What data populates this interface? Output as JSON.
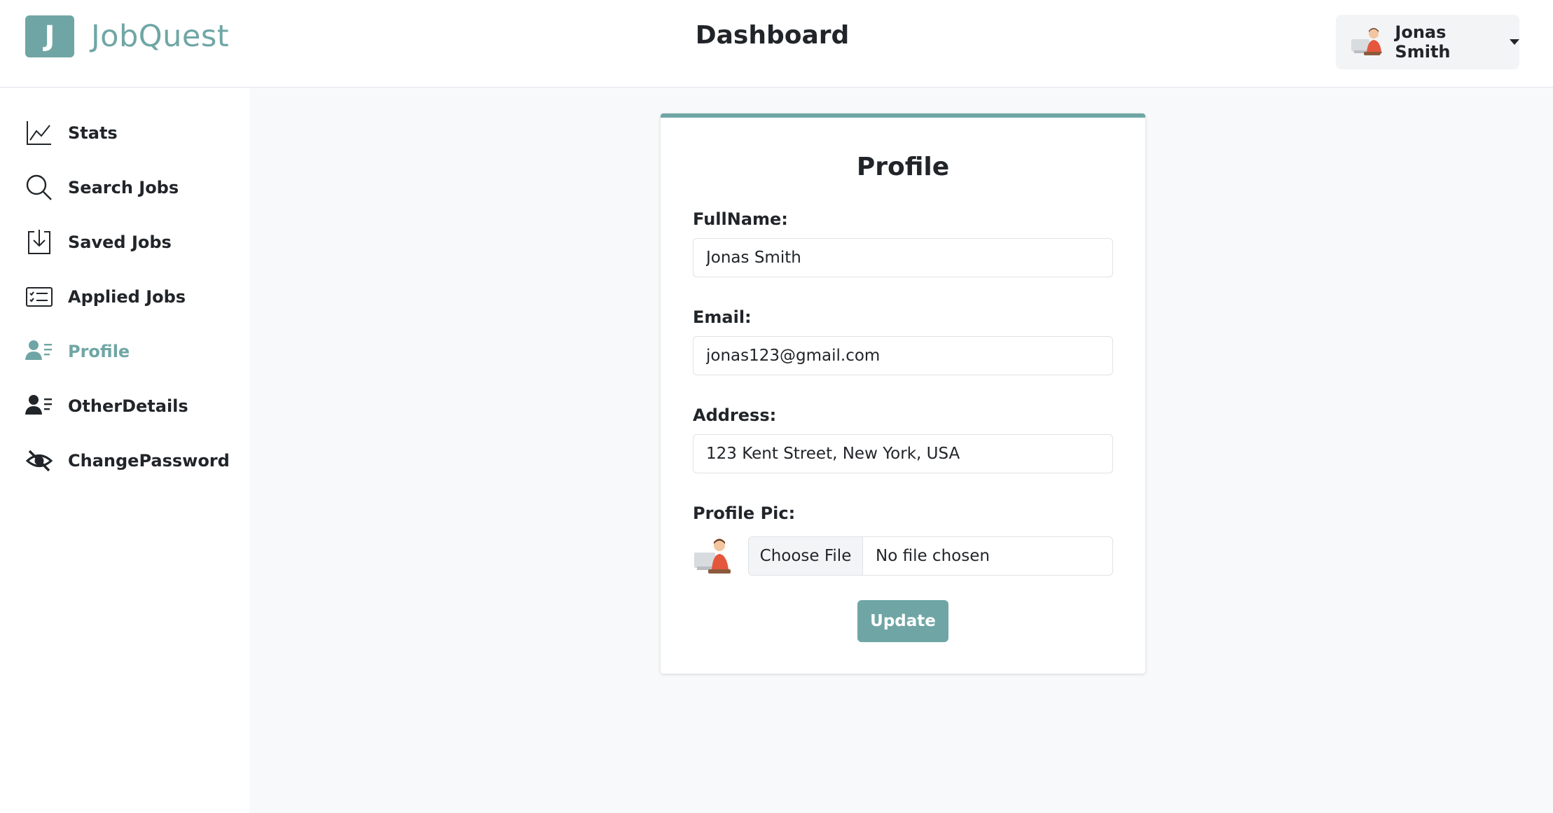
{
  "brand": {
    "initial": "J",
    "name": "JobQuest",
    "color": "#6fa6a5"
  },
  "header": {
    "title": "Dashboard"
  },
  "user": {
    "name": "Jonas Smith",
    "avatar_icon": "developer-avatar-icon"
  },
  "sidebar": {
    "items": [
      {
        "label": "Stats",
        "icon": "line-chart-icon",
        "active": false
      },
      {
        "label": "Search Jobs",
        "icon": "search-icon",
        "active": false
      },
      {
        "label": "Saved Jobs",
        "icon": "download-box-icon",
        "active": false
      },
      {
        "label": "Applied Jobs",
        "icon": "checklist-icon",
        "active": false
      },
      {
        "label": "Profile",
        "icon": "user-list-icon",
        "active": true
      },
      {
        "label": "OtherDetails",
        "icon": "user-details-icon",
        "active": false
      },
      {
        "label": "ChangePassword",
        "icon": "eye-slash-icon",
        "active": false
      }
    ]
  },
  "profile": {
    "title": "Profile",
    "fullname_label": "FullName:",
    "fullname_value": "Jonas Smith",
    "email_label": "Email:",
    "email_value": "jonas123@gmail.com",
    "address_label": "Address:",
    "address_value": "123 Kent Street, New York, USA",
    "pic_label": "Profile Pic:",
    "choose_file_label": "Choose File",
    "file_status": "No file chosen",
    "update_label": "Update"
  }
}
